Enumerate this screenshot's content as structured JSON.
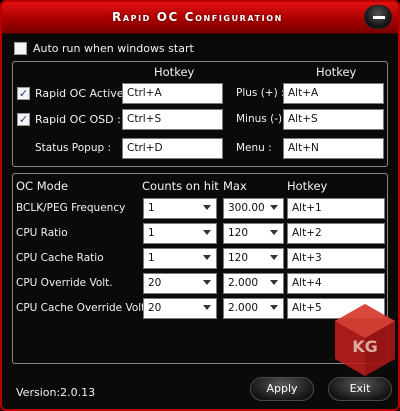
{
  "window": {
    "title": "Rapid OC Configuration"
  },
  "auto_run": {
    "label": "Auto run when windows start",
    "checked": false
  },
  "hotkeys": {
    "hotkey_header_left": "Hotkey",
    "hotkey_header_right": "Hotkey",
    "rows_left": [
      {
        "label": "Rapid OC Active :",
        "checked": true,
        "hotkey": "Ctrl+A"
      },
      {
        "label": "Rapid OC OSD :",
        "checked": true,
        "hotkey": "Ctrl+S"
      },
      {
        "label": "Status Popup :",
        "hotkey": "Ctrl+D"
      }
    ],
    "rows_right": [
      {
        "label": "Plus (+) :",
        "hotkey": "Alt+A"
      },
      {
        "label": "Minus (-) :",
        "hotkey": "Alt+S"
      },
      {
        "label": "Menu :",
        "hotkey": "Alt+N"
      }
    ]
  },
  "oc": {
    "headers": {
      "mode": "OC Mode",
      "counts": "Counts on hit",
      "max": "Max",
      "hotkey": "Hotkey"
    },
    "rows": [
      {
        "mode": "BCLK/PEG Frequency",
        "counts": "1",
        "max": "300.00",
        "hotkey": "Alt+1"
      },
      {
        "mode": "CPU Ratio",
        "counts": "1",
        "max": "120",
        "hotkey": "Alt+2"
      },
      {
        "mode": "CPU Cache Ratio",
        "counts": "1",
        "max": "120",
        "hotkey": "Alt+3"
      },
      {
        "mode": "CPU Override Volt.",
        "counts": "20",
        "max": "2.000",
        "hotkey": "Alt+4"
      },
      {
        "mode": "CPU Cache Override Volt.",
        "counts": "20",
        "max": "2.000",
        "hotkey": "Alt+5"
      }
    ]
  },
  "footer": {
    "version": "Version:2.0.13",
    "apply_label": "Apply",
    "exit_label": "Exit"
  },
  "logo": {
    "text": "KG"
  },
  "colors": {
    "title_red": "#d40000",
    "border_red": "#b80000",
    "logo_red": "#c41e1e"
  }
}
